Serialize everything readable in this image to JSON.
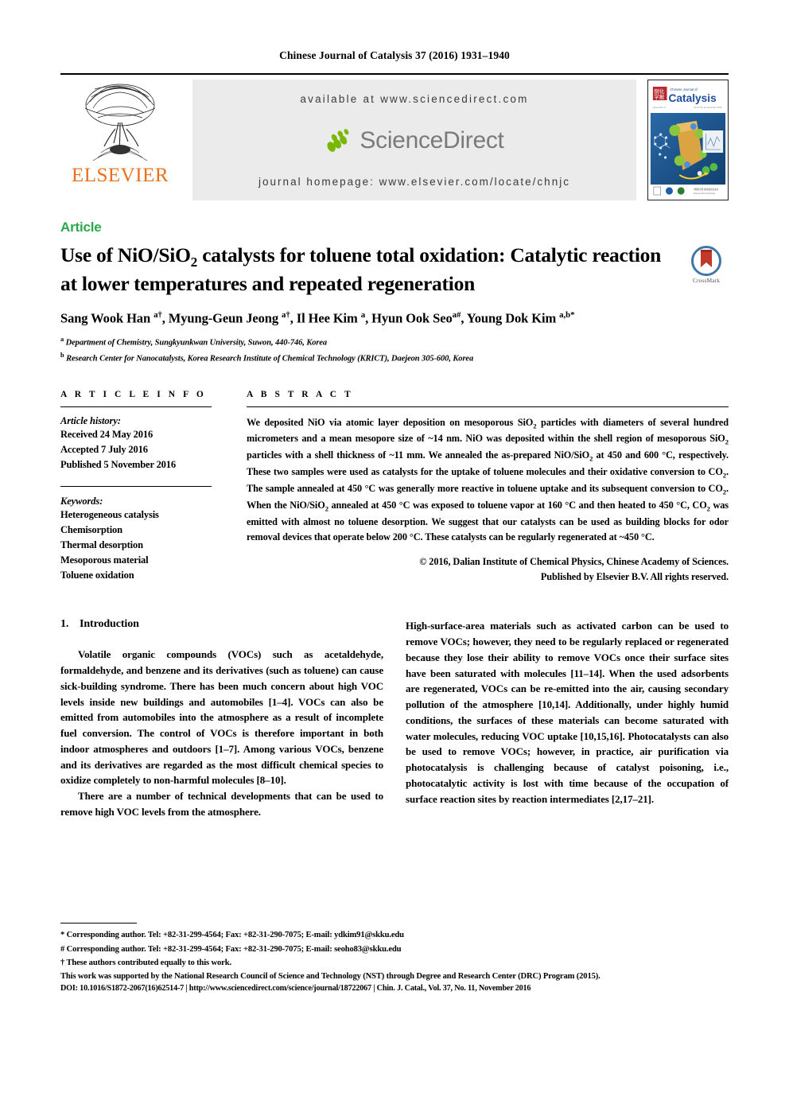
{
  "running_head": "Chinese Journal of Catalysis 37 (2016) 1931–1940",
  "masthead": {
    "publisher_name": "ELSEVIER",
    "available_at": "available at www.sciencedirect.com",
    "sciencedirect_wordmark": "ScienceDirect",
    "journal_homepage": "journal homepage: www.elsevier.com/locate/chnjc",
    "cover_journal_title": "Chinese Journal of",
    "cover_journal_name": "Catalysis"
  },
  "article": {
    "type_label": "Article",
    "title_line1": "Use of NiO/SiO",
    "title_sub1": "2",
    "title_line1b": " catalysts for toluene total oxidation: Catalytic",
    "title_line2": "reaction at lower temperatures and repeated regeneration",
    "title_plain": "Use of NiO/SiO2 catalysts for toluene total oxidation: Catalytic reaction at lower temperatures and repeated regeneration",
    "crossmark_label": "CrossMark",
    "authors": "Sang Wook Han a†, Myung-Geun Jeong a†, Il Hee Kim a, Hyun Ook Seo a#, Young Dok Kim a,b*",
    "affiliation_a": "Department of Chemistry, Sungkyunkwan University, Suwon, 440-746, Korea",
    "affiliation_b": "Research Center for Nanocatalysts, Korea Research Institute of Chemical Technology (KRICT), Daejeon 305-600, Korea",
    "affiliation_a_marker": "a",
    "affiliation_b_marker": "b"
  },
  "article_info": {
    "heading": "A R T I C L E   I N F O",
    "history_title": "Article history:",
    "received": "Received 24 May 2016",
    "accepted": "Accepted 7 July 2016",
    "published": "Published 5 November 2016",
    "keywords_title": "Keywords:",
    "keywords": [
      "Heterogeneous catalysis",
      "Chemisorption",
      "Thermal desorption",
      "Mesoporous material",
      "Toluene oxidation"
    ]
  },
  "abstract": {
    "heading": "A B S T R A C T",
    "text": "We deposited NiO via atomic layer deposition on mesoporous SiO2 particles with diameters of several hundred micrometers and a mean mesopore size of ~14 nm. NiO was deposited within the shell region of mesoporous SiO2 particles with a shell thickness of ~11 mm. We annealed the as-prepared NiO/SiO2 at 450 and 600 °C, respectively. These two samples were used as catalysts for the uptake of toluene molecules and their oxidative conversion to CO2. The sample annealed at 450 °C was generally more reactive in toluene uptake and its subsequent conversion to CO2. When the NiO/SiO2 annealed at 450 °C was exposed to toluene vapor at 160 °C and then heated to 450 °C, CO2 was emitted with almost no toluene desorption. We suggest that our catalysts can be used as building blocks for odor removal devices that operate below 200 °C. These catalysts can be regularly regenerated at ~450 °C.",
    "copyright_line1": "© 2016, Dalian Institute of Chemical Physics, Chinese Academy of Sciences.",
    "copyright_line2": "Published by Elsevier B.V. All rights reserved."
  },
  "introduction": {
    "section_number": "1.",
    "section_title": "Introduction",
    "left_para_1": "Volatile organic compounds (VOCs) such as acetaldehyde, formaldehyde, and benzene and its derivatives (such as toluene) can cause sick-building syndrome. There has been much concern about high VOC levels inside new buildings and automobiles [1–4]. VOCs can also be emitted from automobiles into the atmosphere as a result of incomplete fuel conversion. The control of VOCs is therefore important in both indoor atmospheres and outdoors [1–7]. Among various VOCs, benzene and its derivatives are regarded as the most difficult chemical species to oxidize completely to non-harmful molecules [8–10].",
    "left_para_2": "There are a number of technical developments that can be used to remove high VOC levels from the atmosphere.",
    "right_para_1": "High-surface-area materials such as activated carbon can be used to remove VOCs; however, they need to be regularly replaced or regenerated because they lose their ability to remove VOCs once their surface sites have been saturated with molecules [11–14]. When the used adsorbents are regenerated, VOCs can be re-emitted into the air, causing secondary pollution of the atmosphere [10,14]. Additionally, under highly humid conditions, the surfaces of these materials can become saturated with water molecules, reducing VOC uptake [10,15,16]. Photocatalysts can also be used to remove VOCs; however, in practice, air purification via photocatalysis is challenging because of catalyst poisoning, i.e., photocatalytic activity is lost with time because of the occupation of surface reaction sites by reaction intermediates [2,17–21]."
  },
  "footnotes": {
    "note_1": "* Corresponding author. Tel: +82-31-299-4564; Fax: +82-31-290-7075; E-mail: ydkim91@skku.edu",
    "note_2": "# Corresponding author. Tel: +82-31-299-4564; Fax: +82-31-290-7075; E-mail: seoho83@skku.edu",
    "note_3": "† These authors contributed equally to this work.",
    "funding": "This work was supported by the National Research Council of Science and Technology (NST) through Degree and Research Center (DRC) Program (2015).",
    "doi_line": "DOI: 10.1016/S1872-2067(16)62514-7 | http://www.sciencedirect.com/science/journal/18722067 | Chin. J. Catal., Vol. 37, No. 11, November 2016"
  },
  "colors": {
    "elsevier_orange": "#E9711C",
    "article_green": "#2aa84a",
    "banner_gray": "#ebebeb",
    "sciencedirect_gray": "#7a7a7a",
    "sciencedirect_leaf_green": "#7ab800"
  }
}
